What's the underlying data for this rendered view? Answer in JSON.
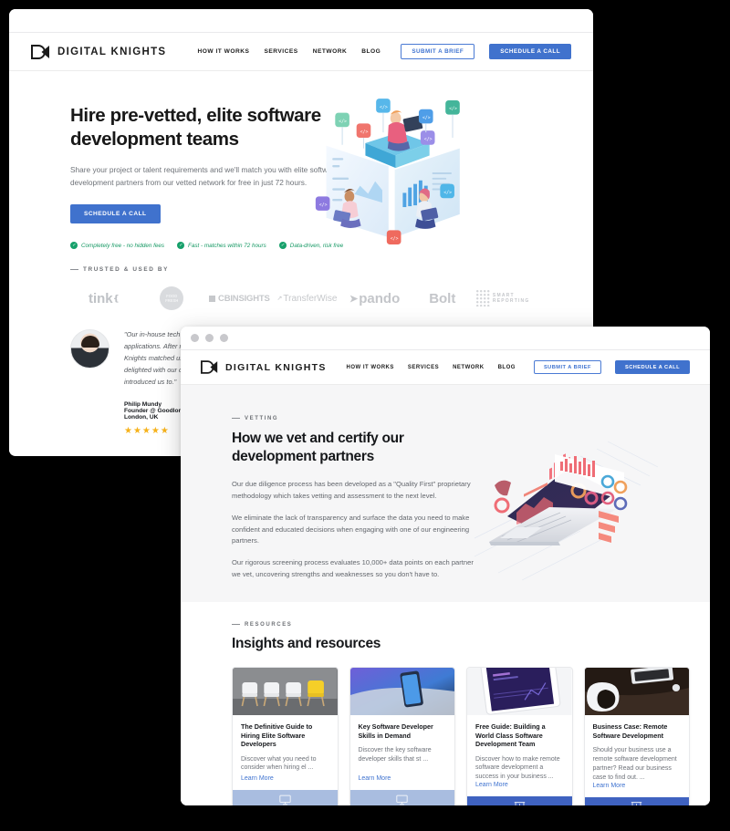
{
  "brand": {
    "name": "DIGITAL KNIGHTS",
    "logo_icon": "dk-monogram-icon"
  },
  "nav": {
    "links": [
      "HOW IT WORKS",
      "SERVICES",
      "NETWORK",
      "BLOG"
    ],
    "secondary_button": "SUBMIT A BRIEF",
    "primary_button": "SCHEDULE A CALL"
  },
  "colors": {
    "primary_blue": "#4072cd",
    "link_blue": "#3f73d0",
    "green": "#16a06a",
    "star_gold": "#f6b21b",
    "section_gray": "#f6f6f7",
    "card_foot_light": "#a9bde0",
    "card_foot_dark": "#3f62c0"
  },
  "hero": {
    "heading": "Hire pre-vetted, elite software development teams",
    "subheading": "Share your project or talent requirements and we'll match you with elite software development partners from our vetted network for free in just 72 hours.",
    "cta": "SCHEDULE A CALL",
    "benefits": [
      "Completely free - no hidden fees",
      "Fast - matches within 72 hours",
      "Data-driven, risk free"
    ],
    "illustration": "isometric-dev-team-illustration"
  },
  "trusted": {
    "eyebrow": "TRUSTED & USED BY",
    "logos": [
      "tink",
      "FOOD FRESH",
      "CBINSIGHTS",
      "TransferWise",
      "pando",
      "Bolt",
      "SMART REPORTING"
    ]
  },
  "testimonial": {
    "quote": "\"Our in-house tech team needed additional support for our web and mobile applications. After many months of attempting to source the right talent, Digital Knights matched us with an excellent partner within a matter of days. We are delighted with our decision to work with Digital Knights and the team that they introduced us to.\"",
    "author_name": "Philip Mundy",
    "author_role": "Founder @ Goodlord and Arkera",
    "author_location": "London, UK",
    "rating": "★★★★★",
    "avatar": "user-avatar"
  },
  "vetting": {
    "eyebrow": "VETTING",
    "heading": "How we vet and certify our development partners",
    "paragraphs": [
      "Our due diligence process has been developed as a \"Quality First\" proprietary methodology which takes vetting and assessment to the next level.",
      "We eliminate the lack of transparency and surface the data you need to make confident and educated decisions when engaging with one of our engineering partners.",
      "Our rigorous screening process evaluates 10,000+ data points on each partner we vet, uncovering strengths and weaknesses so you don't have to."
    ],
    "illustration": "isometric-laptop-analytics-illustration"
  },
  "resources": {
    "eyebrow": "RESOURCES",
    "heading": "Insights and resources",
    "cards": [
      {
        "title": "The Definitive Guide to Hiring Elite Software Developers",
        "description": "Discover what you need to consider when hiring el ...",
        "link": "Learn More",
        "image": "white-chairs-yellow-chair-photo",
        "footer_icon": "monitor-icon",
        "footer_style": "light"
      },
      {
        "title": "Key Software Developer Skills in Demand",
        "description": "Discover the key software developer skills that st ...",
        "link": "Learn More",
        "image": "smartphone-keyboard-photo",
        "footer_icon": "monitor-icon",
        "footer_style": "light"
      },
      {
        "title": "Free Guide: Building a World Class Software Development Team",
        "description": "Discover how to make remote software development a success in your business ...",
        "link": "Learn More",
        "image": "tablet-ebook-cover-photo",
        "footer_icon": "presentation-chart-icon",
        "footer_style": "dark"
      },
      {
        "title": "Business Case: Remote Software Development",
        "description": "Should your business use a remote software development partner? Read our business case to find out. ...",
        "link": "Learn More",
        "image": "desk-laptop-mug-photo",
        "footer_icon": "presentation-chart-icon",
        "footer_style": "dark"
      }
    ]
  }
}
